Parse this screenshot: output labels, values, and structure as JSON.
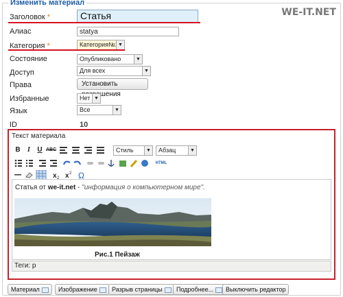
{
  "legend": "Изменить материал",
  "watermark": "WE-IT.NET",
  "colors": {
    "accent": "#d60f1f",
    "legend": "#1f5ea8",
    "required": "#e07a1a"
  },
  "form": {
    "title_label": "Заголовок",
    "required_mark": "*",
    "title_value": "Статья",
    "alias_label": "Алиас",
    "alias_value": "statya",
    "category_label": "Категория",
    "category_value": "Категория№1",
    "state_label": "Состояние",
    "state_value": "Опубликовано",
    "access_label": "Доступ",
    "access_value": "Для всех",
    "rights_label": "Права",
    "rights_button": "Установить разрешения",
    "featured_label": "Избранные",
    "featured_value": "Нет",
    "language_label": "Язык",
    "language_value": "Все",
    "id_label": "ID",
    "id_value": "10"
  },
  "editor": {
    "label": "Текст материала",
    "style_select": "Стиль",
    "format_select": "Абзац",
    "html_button": "HTML",
    "content": {
      "text_before": "Статья от ",
      "site": "we-it.net",
      "dash": " - ",
      "quote": "\"информация о компьютерном мире\".",
      "caption": "Рис.1 Пейзаж"
    },
    "path": "Теги: p"
  },
  "buttons": {
    "article": "Материал",
    "image": "Изображение",
    "pagebreak": "Разрыв страницы",
    "readmore": "Подробнее...",
    "toggle": "Выключить редактор"
  }
}
